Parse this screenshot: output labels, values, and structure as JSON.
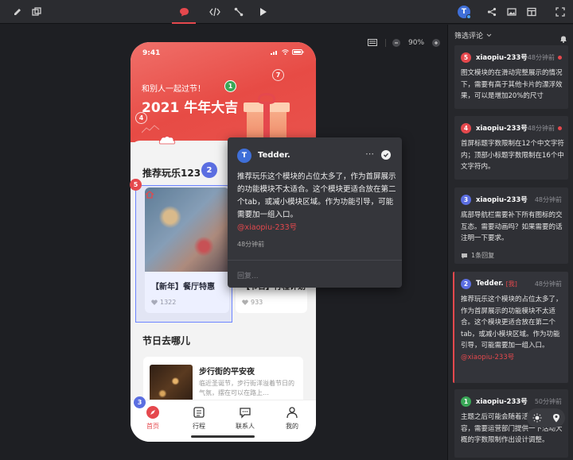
{
  "toolbar": {
    "avatar_initial": "T",
    "icons": [
      "edit-icon",
      "layers-icon",
      "comment-icon",
      "code-icon",
      "flow-icon",
      "play-icon",
      "share-icon",
      "image-icon",
      "layout-icon",
      "fullscreen-icon"
    ]
  },
  "zoom": {
    "level": "90%"
  },
  "phone": {
    "time": "9:41",
    "banner_subtitle": "和别人一起过节！",
    "banner_title": "2021 牛年大吉",
    "section1_title": "推荐玩乐123",
    "card1_title": "【新年】餐厅特惠",
    "card1_likes": "1322",
    "card2_title": "【节日】行程计划",
    "card2_likes": "933",
    "section2_title": "节日去哪儿",
    "card3_title": "步行街的平安夜",
    "card3_desc": "临近圣诞节，步行街洋溢着节日的气氛，摆在可以在路上…",
    "tabs": [
      "首页",
      "行程",
      "联系人",
      "我的"
    ]
  },
  "markers": [
    "1",
    "2",
    "3",
    "4",
    "5",
    "7"
  ],
  "popover": {
    "avatar_initial": "T",
    "author": "Tedder.",
    "text": "推荐玩乐这个模块的占位太多了，作为首屏展示的功能模块不太适合。这个模块更适合放在第二个tab，或减小模块区域。作为功能引导，可能需要加一组入口。",
    "mention": "@xiaopiu-233号",
    "time": "48分钟前",
    "reply_placeholder": "回复..."
  },
  "panel": {
    "filter_label": "筛选评论",
    "comments": [
      {
        "num": "5",
        "color": "#e5484d",
        "author": "xiaopiu-233号",
        "tag": "",
        "time": "48分钟前",
        "unread": true,
        "body": "图文模块的在滑动完整展示的情况下，需要有高于其他卡片的漂浮效果，可以是增加20%的尺寸",
        "mention": "",
        "reply": ""
      },
      {
        "num": "4",
        "color": "#e5484d",
        "author": "xiaopiu-233号",
        "tag": "",
        "time": "48分钟前",
        "unread": true,
        "body": "首屏标题字数限制在12个中文字符内；顶部小标题字数限制在16个中文字符内。",
        "mention": "",
        "reply": ""
      },
      {
        "num": "3",
        "color": "#5b6ee1",
        "author": "xiaopiu-233号",
        "tag": "",
        "time": "48分钟前",
        "unread": false,
        "body": "底部导航栏需要补下所有图标的交互态。需要动画吗？如果需要的话注明一下要求。",
        "mention": "",
        "reply": "1条回复"
      },
      {
        "num": "2",
        "color": "#5b6ee1",
        "author": "Tedder.",
        "tag": "[我]",
        "time": "48分钟前",
        "unread": false,
        "body": "推荐玩乐这个模块的占位太多了，作为首屏展示的功能模块不太适合。这个模块更适合放在第二个tab，或减小模块区域。作为功能引导，可能需要加一组入口。",
        "mention": "@xiaopiu-233号",
        "reply": ""
      },
      {
        "num": "1",
        "color": "#3aa757",
        "author": "xiaopiu-233号",
        "tag": "",
        "time": "50分钟前",
        "unread": false,
        "body": "主题之后可能会随着活动而更换内容，需要运营部门提供一下活动大概的字数限制作出设计调整。",
        "mention": "",
        "reply": ""
      }
    ]
  }
}
